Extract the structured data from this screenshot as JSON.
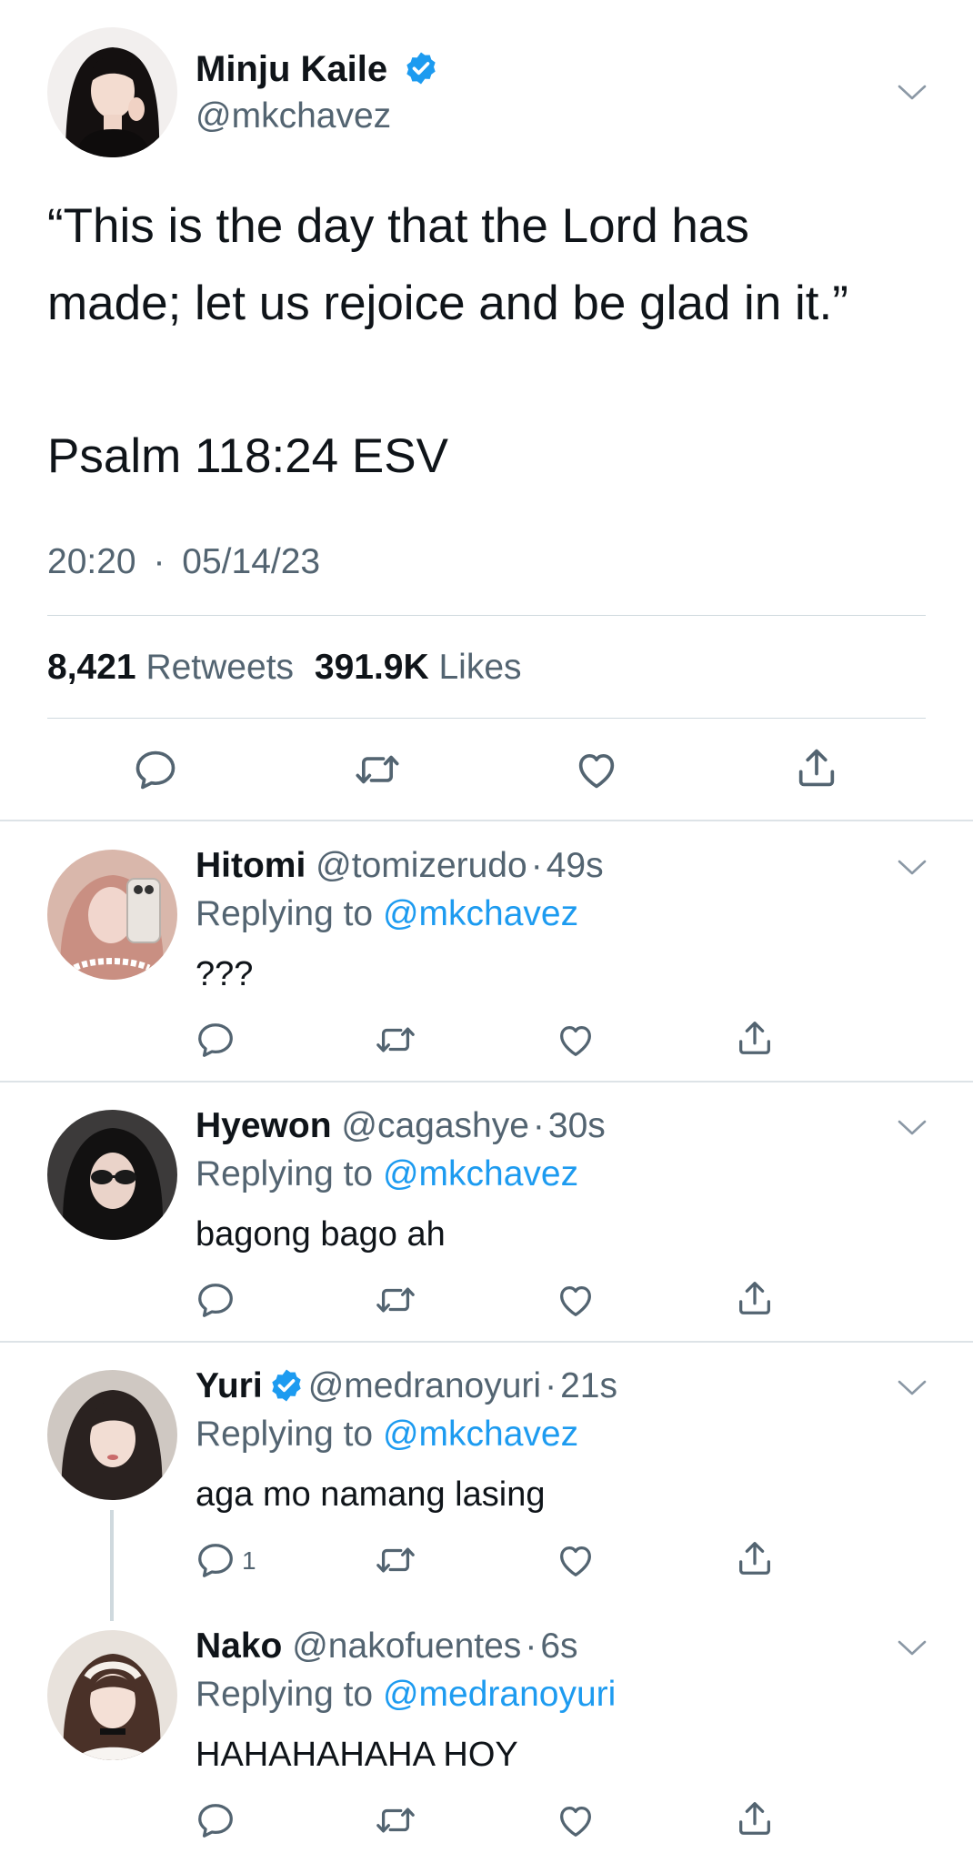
{
  "main_tweet": {
    "name": "Minju Kaile",
    "handle": "@mkchavez",
    "text_lines": [
      "“This is the day that the Lord has",
      "made; let us rejoice and be glad in it.”",
      "Psalm 118:24 ESV"
    ],
    "time": "20:20",
    "separator": "·",
    "date": "05/14/23",
    "retweets_count": "8,421",
    "retweets_label": "Retweets",
    "likes_count": "391.9K",
    "likes_label": "Likes",
    "verified": true
  },
  "replies": [
    {
      "name": "Hitomi",
      "handle": "@tomizerudo",
      "sep": "·",
      "time": "49s",
      "replying_label": "Replying to",
      "replying_to": "@mkchavez",
      "text": "???",
      "reply_count": ""
    },
    {
      "name": "Hyewon",
      "handle": "@cagashye",
      "sep": "·",
      "time": "30s",
      "replying_label": "Replying to",
      "replying_to": "@mkchavez",
      "text": "bagong bago ah",
      "reply_count": ""
    },
    {
      "name": "Yuri",
      "handle": "@medranoyuri",
      "sep": "·",
      "time": "21s",
      "replying_label": "Replying to",
      "replying_to": "@mkchavez",
      "text": "aga mo namang lasing",
      "reply_count": "1",
      "verified": true
    },
    {
      "name": "Nako",
      "handle": "@nakofuentes",
      "sep": "·",
      "time": "6s",
      "replying_label": "Replying to",
      "replying_to": "@medranoyuri",
      "text": "HAHAHAHAHA HOY",
      "reply_count": ""
    }
  ],
  "icons": [
    "reply-icon",
    "retweet-icon",
    "like-icon",
    "share-icon",
    "chevron-down-icon",
    "verified-badge-icon"
  ],
  "colors": {
    "accent": "#1d9bf0",
    "text": "#0f1419",
    "secondary": "#536471",
    "divider": "#cfd9de"
  }
}
